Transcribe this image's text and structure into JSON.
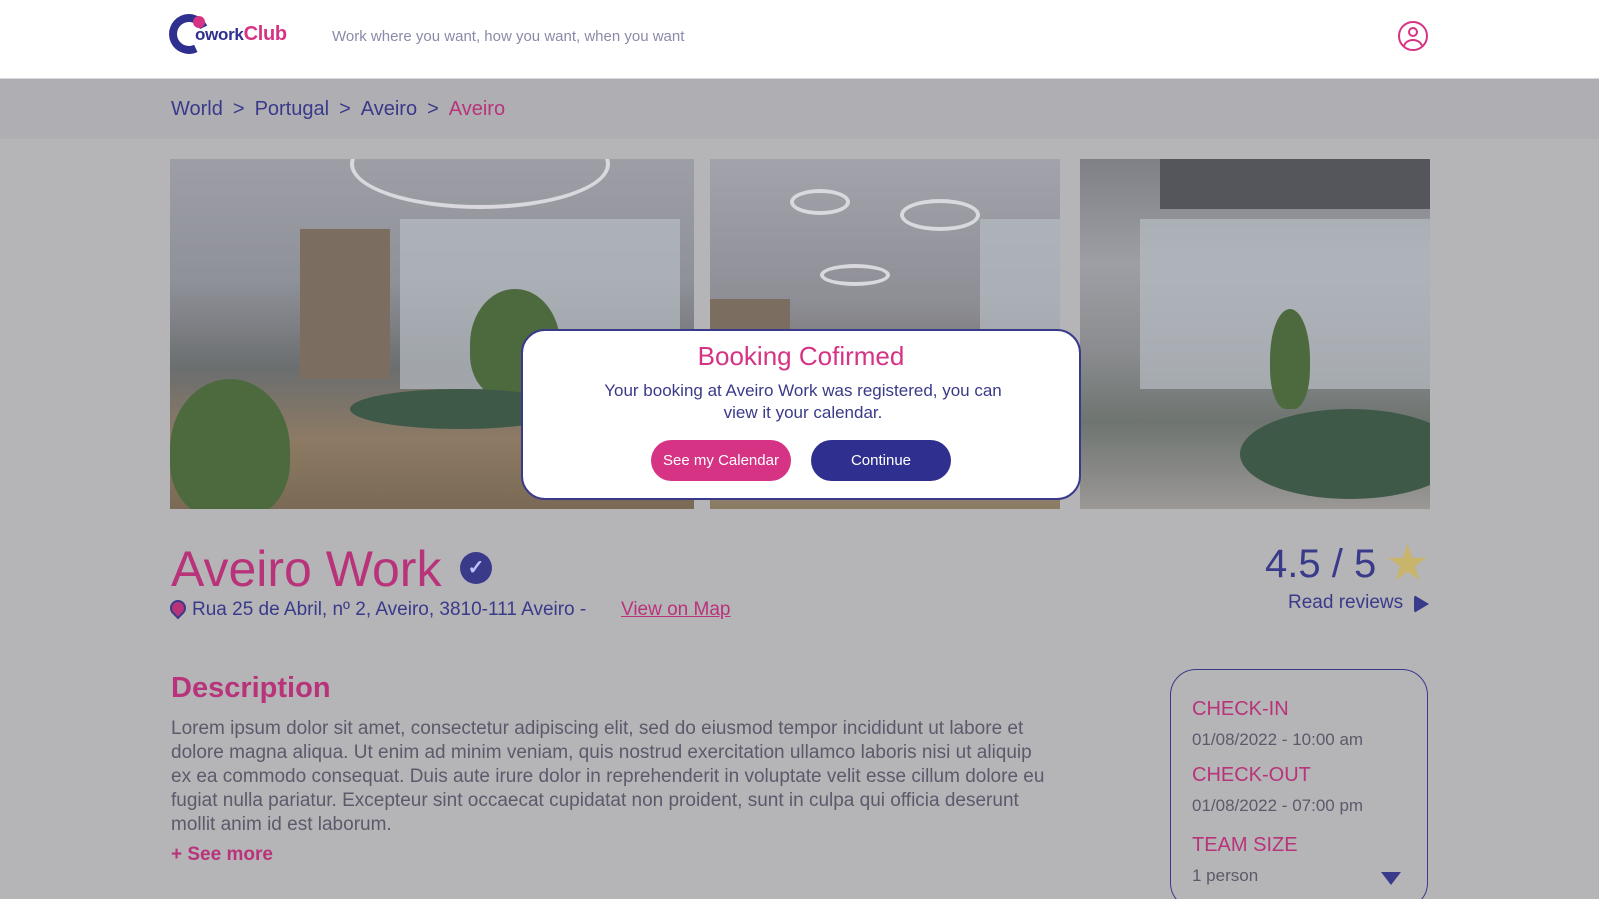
{
  "header": {
    "logo_text_a": "owork",
    "logo_text_b": "Club",
    "tagline": "Work where you want, how you want, when you want"
  },
  "breadcrumb": [
    "World",
    "Portugal",
    "Aveiro",
    "Aveiro"
  ],
  "breadcrumb_separator": ">",
  "space": {
    "name": "Aveiro Work",
    "address": "Rua 25 de Abril, nº 2,  Aveiro, 3810-111 Aveiro -",
    "map_link": "View on Map",
    "rating": "4.5 / 5",
    "read_reviews": "Read reviews"
  },
  "description": {
    "title": "Description",
    "text": "Lorem ipsum dolor sit amet, consectetur adipiscing elit, sed do eiusmod tempor incididunt ut labore et dolore magna aliqua. Ut enim ad minim veniam, quis nostrud exercitation ullamco laboris nisi ut aliquip ex ea commodo consequat. Duis aute irure dolor in reprehenderit in voluptate velit esse cillum dolore eu fugiat nulla pariatur. Excepteur sint occaecat cupidatat non proident, sunt in culpa qui officia deserunt mollit anim id est laborum.",
    "see_more": "+ See more"
  },
  "booking": {
    "checkin_label": "CHECK-IN",
    "checkin_value": "01/08/2022 - 10:00 am",
    "checkout_label": "CHECK-OUT",
    "checkout_value": "01/08/2022 - 07:00 pm",
    "team_label": "TEAM SIZE",
    "team_value": "1 person"
  },
  "modal": {
    "title": "Booking Cofirmed",
    "text": "Your booking at Aveiro Work was registered, you can view it your calendar.",
    "calendar_button": "See my Calendar",
    "continue_button": "Continue"
  },
  "colors": {
    "primary": "#2f2f8f",
    "accent": "#d63384",
    "overlay": "#b5b5b8"
  },
  "icons": [
    "user-icon",
    "verified-icon",
    "pin-icon",
    "star-icon",
    "play-icon",
    "dropdown-arrow-icon"
  ]
}
